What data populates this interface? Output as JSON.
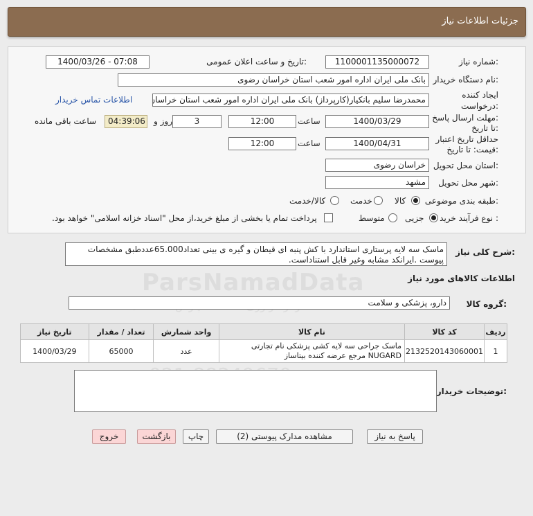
{
  "header": {
    "title": "جزئیات اطلاعات نیاز"
  },
  "form": {
    "need_number_label": "شماره نیاز:",
    "need_number": "1100001135000072",
    "announce_label": "تاریخ و ساعت اعلان عمومی:",
    "announce_value": "1400/03/26 - 07:08",
    "buyer_org_label": "نام دستگاه خریدار:",
    "buyer_org": "بانک ملی ایران اداره امور شعب استان خراسان رضوی",
    "creator_label_1": "ایجاد کننده",
    "creator_label_2": "درخواست:",
    "creator": "محمدرضا سلیم  بانکیار(کارپرداز) بانک ملی ایران اداره امور شعب استان خراسان رضوی",
    "contact_link": "اطلاعات تماس خریدار",
    "deadline_label_1": "مهلت ارسال پاسخ:",
    "deadline_label_2": "تا تاریخ:",
    "deadline_date": "1400/03/29",
    "time_label": "ساعت",
    "deadline_time": "12:00",
    "days_value": "3",
    "days_label": "روز و",
    "remaining_time": "04:39:06",
    "remaining_label": "ساعت باقی مانده",
    "validity_label_1": "حداقل تاریخ اعتبار",
    "validity_label_2": "قیمت: تا تاریخ:",
    "validity_date": "1400/04/31",
    "validity_time": "12:00",
    "province_label": "استان محل تحویل:",
    "province": "خراسان رضوی",
    "city_label": "شهر محل تحویل:",
    "city": "مشهد",
    "category_label": "طبقه بندی موضوعی:",
    "category_options": [
      "کالا",
      "خدمت",
      "کالا/خدمت"
    ],
    "category_selected": "کالا",
    "process_label": "نوع فرآیند خرید :",
    "process_options": [
      "جزیی",
      "متوسط"
    ],
    "process_selected": "جزیی",
    "payment_note": "پرداخت تمام یا بخشی از مبلغ خرید،از محل \"اسناد خزانه اسلامی\" خواهد بود."
  },
  "summary": {
    "label": "شرح کلی نیاز:",
    "text": "ماسک سه لایه پرستاری استاندارد با کش پنبه ای قیطان و گیره ی بینی تعداد65.000عددطبق مشخصات پیوست .ایرانکد مشابه وغیر قابل استناداست."
  },
  "goods_info_title": "اطلاعات کالاهای مورد نیاز",
  "goods_group": {
    "label": "گروه کالا:",
    "value": "دارو، پزشکی و سلامت"
  },
  "table": {
    "headers": [
      "ردیف",
      "کد کالا",
      "نام کالا",
      "واحد شمارش",
      "تعداد / مقدار",
      "تاریخ نیاز"
    ],
    "rows": [
      {
        "index": "1",
        "code": "2132520143060001",
        "name": "ماسک جراحی سه لایه کشی پزشکی نام تجارتی NUGARD مرجع عرضه کننده بیتاساز",
        "unit": "عدد",
        "quantity": "65000",
        "date": "1400/03/29"
      }
    ]
  },
  "buyer_notes": {
    "label": "توضیحات خریدار:",
    "value": ""
  },
  "buttons": {
    "reply": "پاسخ به نیاز",
    "attachments": "مشاهده مدارک پیوستی (2)",
    "print": "چاپ",
    "back": "بازگشت",
    "exit": "خروج"
  },
  "watermark": {
    "brand": "ParsNamadData",
    "line1": "مرکز فراوری اطلاعات پارس نماد داده",
    "phone": "021-88349670"
  }
}
